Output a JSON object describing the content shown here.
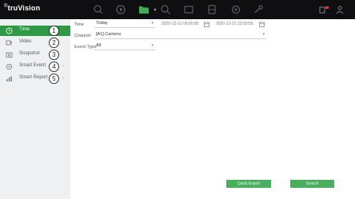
{
  "app": {
    "logo_name": "truVision",
    "logo_mark": "®"
  },
  "topbar": {
    "icons": [
      "live-view-icon",
      "playback-icon",
      "folder-icon",
      "search-icon",
      "display-icon",
      "storage-icon",
      "settings-icon",
      "tools-icon",
      "alarm-icon",
      "user-icon"
    ]
  },
  "sidebar": {
    "items": [
      {
        "label": "Time",
        "num": "1",
        "icon": "clock-icon",
        "active": true
      },
      {
        "label": "Video",
        "num": "2",
        "icon": "video-icon",
        "active": false
      },
      {
        "label": "Snapshot",
        "num": "3",
        "icon": "snapshot-icon",
        "active": false
      },
      {
        "label": "Smart Event",
        "num": "4",
        "icon": "smart-event-icon",
        "active": false
      },
      {
        "label": "Smart Report",
        "num": "5",
        "icon": "report-icon",
        "active": false
      }
    ]
  },
  "form": {
    "time_label": "Time",
    "time_value": "Today",
    "start_time": "2020-12-21 00:00:00",
    "end_time": "2020-12-21 23:59:59",
    "channel_label": "Channel",
    "channel_value": "[A1] Camera",
    "event_type_label": "Event Type",
    "event_type_value": "All"
  },
  "actions": {
    "left_label": "Quick Export",
    "right_label": "Search"
  },
  "colors": {
    "accent": "#2f9a46",
    "topbar": "#0f0f12",
    "sidebar": "#eef0f1"
  }
}
